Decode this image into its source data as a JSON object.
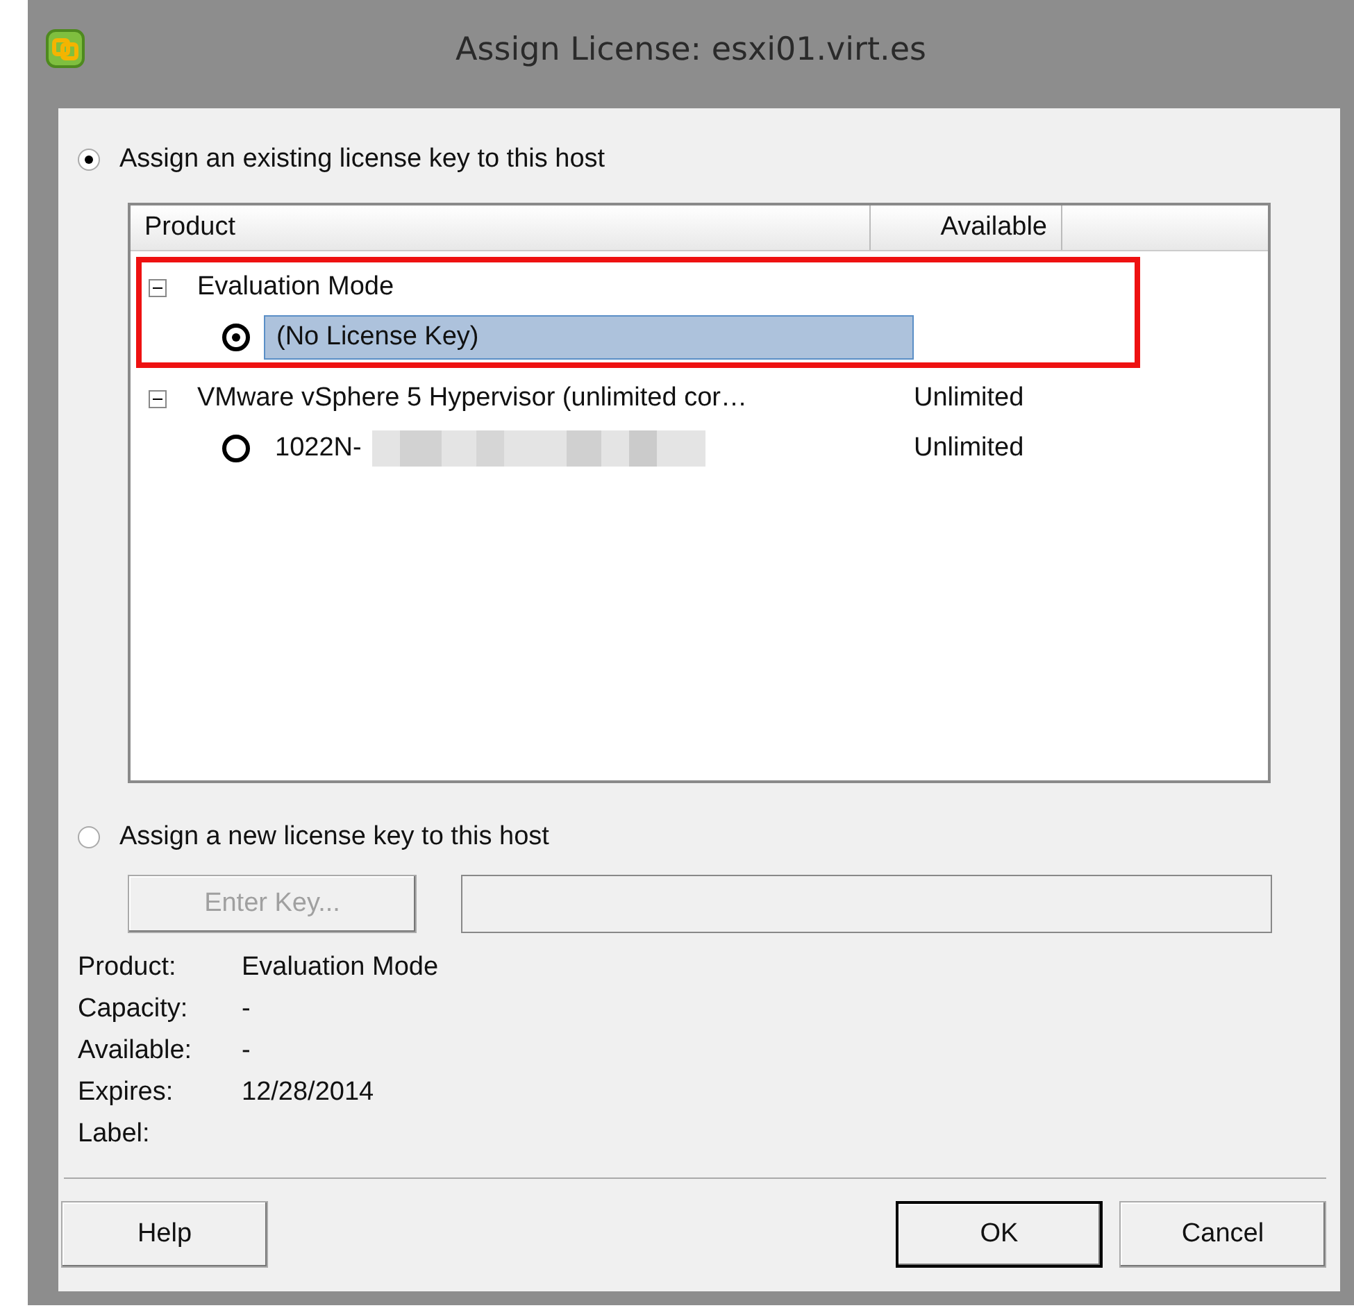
{
  "window": {
    "title": "Assign License: esxi01.virt.es"
  },
  "existing_option": {
    "label": "Assign an existing license key to this host",
    "selected": true
  },
  "license_table": {
    "columns": [
      "Product",
      "Available"
    ],
    "groups": [
      {
        "product": "Evaluation Mode",
        "expanded": true,
        "annotated": true,
        "children": [
          {
            "product": "(No License Key)",
            "selected": true,
            "redacted": false
          }
        ]
      },
      {
        "product": "VMware vSphere 5 Hypervisor (unlimited cor…",
        "available": "Unlimited",
        "expanded": true,
        "annotated": false,
        "children": [
          {
            "product": "1022N-",
            "available": "Unlimited",
            "selected": false,
            "redacted": true
          }
        ]
      }
    ]
  },
  "new_option": {
    "label": "Assign a new license key to this host",
    "selected": false
  },
  "enter_key_button": {
    "label": "Enter Key...",
    "disabled": true
  },
  "details": [
    {
      "label": "Product:",
      "value": "Evaluation Mode"
    },
    {
      "label": "Capacity:",
      "value": "-"
    },
    {
      "label": "Available:",
      "value": "-"
    },
    {
      "label": "Expires:",
      "value": "12/28/2014"
    },
    {
      "label": "Label:"
    }
  ],
  "buttons": [
    {
      "label": "Help",
      "default": false
    },
    {
      "label": "OK",
      "default": true
    },
    {
      "label": "Cancel",
      "default": false
    }
  ]
}
